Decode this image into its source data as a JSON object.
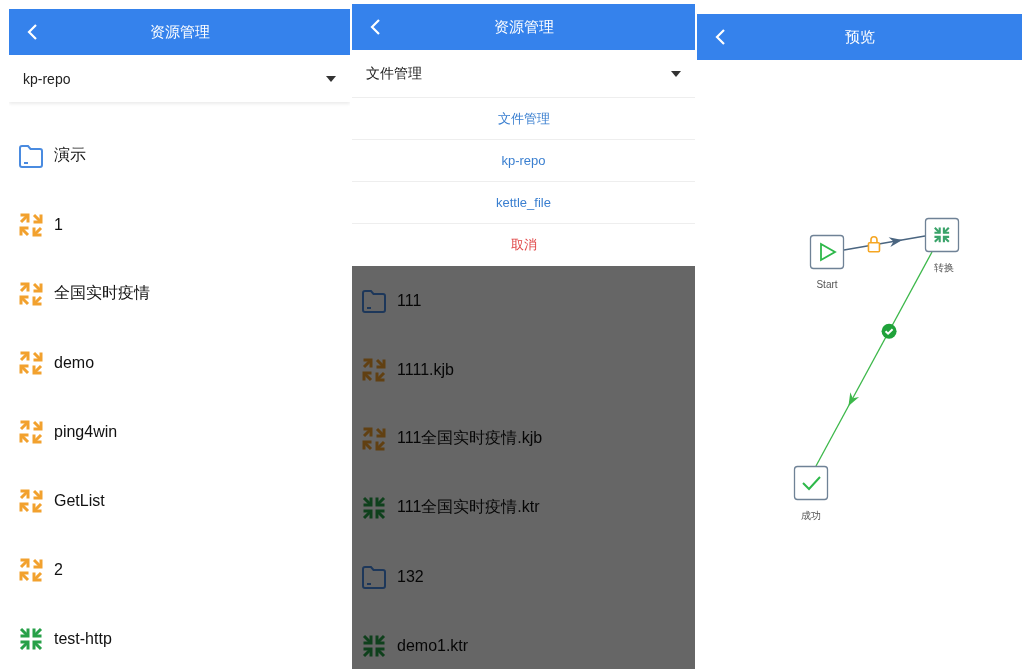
{
  "screens": [
    {
      "kind": "list",
      "header": {
        "title": "资源管理"
      },
      "selector": {
        "value": "kp-repo"
      },
      "dimmed": false,
      "items": [
        {
          "kind": "folder",
          "name": "演示"
        },
        {
          "kind": "job",
          "name": "1"
        },
        {
          "kind": "job",
          "name": "全国实时疫情"
        },
        {
          "kind": "job",
          "name": "demo"
        },
        {
          "kind": "job",
          "name": "ping4win"
        },
        {
          "kind": "job",
          "name": "GetList"
        },
        {
          "kind": "job",
          "name": "2"
        },
        {
          "kind": "transform",
          "name": "test-http"
        }
      ]
    },
    {
      "kind": "list",
      "header": {
        "title": "资源管理"
      },
      "selector": {
        "value": "文件管理"
      },
      "sheet": [
        {
          "kind": "option",
          "label": "文件管理"
        },
        {
          "kind": "option",
          "label": "kp-repo"
        },
        {
          "kind": "option",
          "label": "kettle_file"
        },
        {
          "kind": "cancel",
          "label": "取消"
        }
      ],
      "dimmed": true,
      "items": [
        {
          "kind": "folder",
          "name": "111"
        },
        {
          "kind": "job",
          "name": "1111.kjb"
        },
        {
          "kind": "job",
          "name": "111全国实时疫情.kjb"
        },
        {
          "kind": "transform",
          "name": "111全国实时疫情.ktr"
        },
        {
          "kind": "folder",
          "name": "132"
        },
        {
          "kind": "transform",
          "name": "demo1.ktr"
        }
      ]
    },
    {
      "kind": "diagram",
      "header": {
        "title": "预览"
      },
      "nodes": [
        {
          "kind": "start",
          "label": "Start"
        },
        {
          "kind": "transform",
          "label": "转换"
        },
        {
          "kind": "success",
          "label": "成功"
        }
      ],
      "edges": [
        {
          "kind": "locked"
        },
        {
          "kind": "success"
        }
      ]
    }
  ]
}
